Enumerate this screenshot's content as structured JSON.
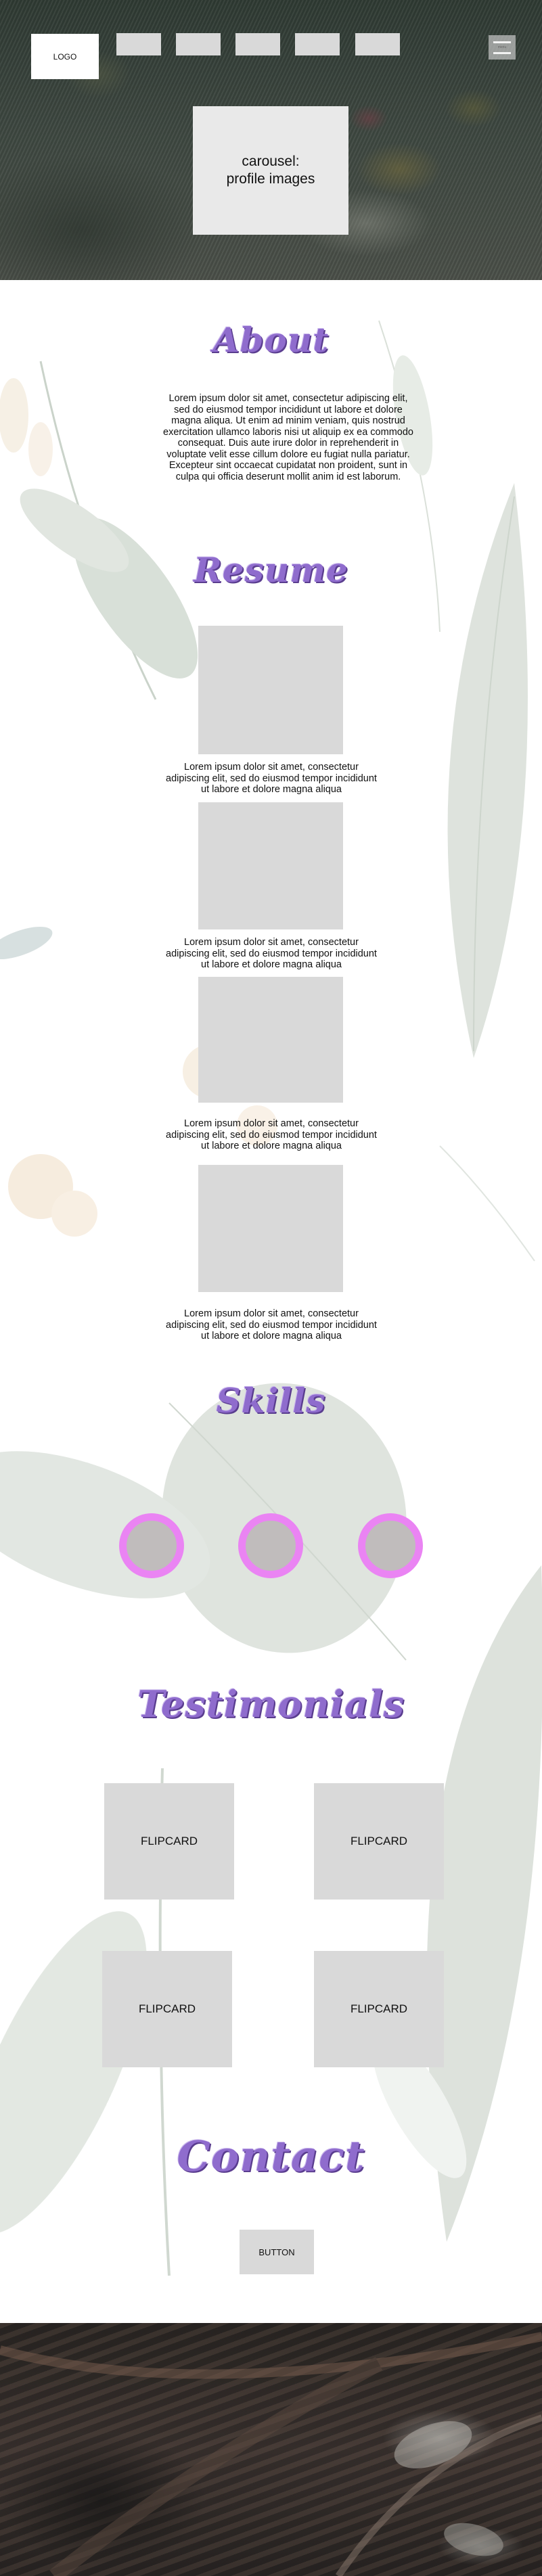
{
  "header": {
    "logo": "LOGO",
    "menu_label": "menu",
    "carousel_line1": "carousel:",
    "carousel_line2": "profile images"
  },
  "about": {
    "heading": "About",
    "body": "Lorem ipsum dolor sit amet, consectetur adipiscing elit, sed do eiusmod tempor incididunt ut labore et dolore magna aliqua. Ut enim ad minim veniam, quis nostrud exercitation ullamco laboris nisi ut aliquip ex ea commodo consequat. Duis aute irure dolor in reprehenderit in voluptate velit esse cillum dolore eu fugiat nulla pariatur. Excepteur sint occaecat cupidatat non proident, sunt in culpa qui officia deserunt mollit anim id est laborum."
  },
  "resume": {
    "heading": "Resume",
    "items": [
      {
        "caption": "Lorem ipsum dolor sit amet, consectetur adipiscing elit, sed do eiusmod tempor incididunt ut labore et dolore magna aliqua"
      },
      {
        "caption": "Lorem ipsum dolor sit amet, consectetur adipiscing elit, sed do eiusmod tempor incididunt ut labore et dolore magna aliqua"
      },
      {
        "caption": "Lorem ipsum dolor sit amet, consectetur adipiscing elit, sed do eiusmod tempor incididunt ut labore et dolore magna aliqua"
      },
      {
        "caption": "Lorem ipsum dolor sit amet, consectetur adipiscing elit, sed do eiusmod tempor incididunt ut labore et dolore magna aliqua"
      }
    ]
  },
  "skills": {
    "heading": "Skills",
    "ring_color": "#ea84f3"
  },
  "testimonials": {
    "heading": "Testimonials",
    "cards": [
      "FLIPCARD",
      "FLIPCARD",
      "FLIPCARD",
      "FLIPCARD"
    ]
  },
  "contact": {
    "heading": "Contact",
    "button_label": "BUTTON"
  },
  "colors": {
    "heading_purple": "#8f6ccd",
    "placeholder_gray": "#d9d9d9"
  }
}
